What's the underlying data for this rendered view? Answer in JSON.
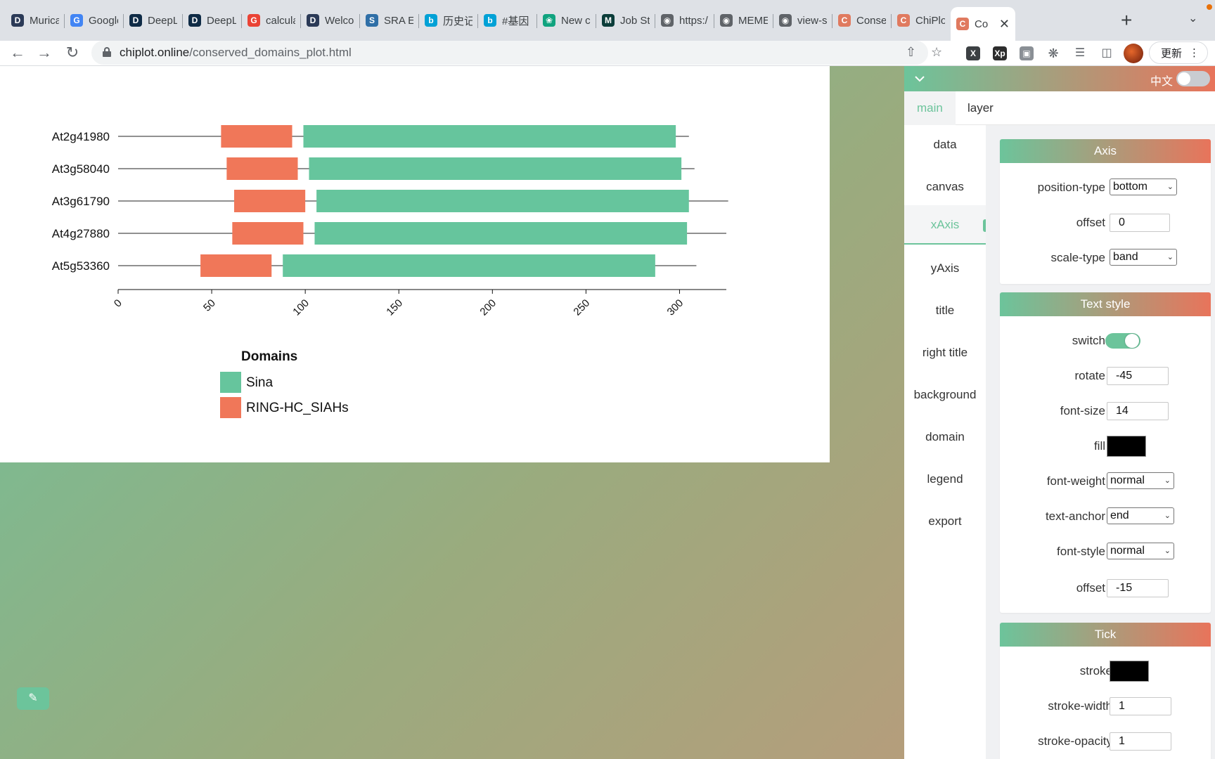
{
  "browser": {
    "tabs": [
      {
        "label": "Muricat",
        "icon": "deepl-logo-icon",
        "color": "#2b3a57"
      },
      {
        "label": "Google",
        "icon": "google-translate-icon",
        "color": "#4285f4"
      },
      {
        "label": "DeepL",
        "icon": "deepl-icon",
        "color": "#0f2b46"
      },
      {
        "label": "DeepL",
        "icon": "deepl-icon",
        "color": "#0f2b46"
      },
      {
        "label": "calcula",
        "icon": "google-icon",
        "color": "#ea4335"
      },
      {
        "label": "Welco",
        "icon": "deepl-logo-icon",
        "color": "#2b3a57"
      },
      {
        "label": "SRA E",
        "icon": "sra-icon",
        "color": "#2f6fa7"
      },
      {
        "label": "历史记",
        "icon": "bilibili-icon",
        "color": "#00a1d6"
      },
      {
        "label": "#基因",
        "icon": "bilibili-icon",
        "color": "#00a1d6"
      },
      {
        "label": "New c",
        "icon": "openai-icon",
        "color": "#10a37f"
      },
      {
        "label": "Job St",
        "icon": "m-logo-icon",
        "color": "#0b3d3a"
      },
      {
        "label": "https:/",
        "icon": "globe-icon",
        "color": "#5f6368"
      },
      {
        "label": "MEME",
        "icon": "globe-icon",
        "color": "#5f6368"
      },
      {
        "label": "view-s",
        "icon": "globe-icon",
        "color": "#5f6368"
      },
      {
        "label": "Conse",
        "icon": "chiplot-icon",
        "color": "#e07a5f"
      },
      {
        "label": "ChiPlo",
        "icon": "chiplot-icon",
        "color": "#e07a5f"
      },
      {
        "label": "Co",
        "icon": "chiplot-icon",
        "color": "#e07a5f",
        "active": true
      }
    ],
    "url_host": "chiplot.online",
    "url_path": "/conserved_domains_plot.html",
    "update_label": "更新"
  },
  "panel": {
    "lang_label": "中文",
    "top_tabs": [
      "main",
      "layer"
    ],
    "nav": [
      "data",
      "canvas",
      "xAxis",
      "yAxis",
      "title",
      "right title",
      "background",
      "domain",
      "legend",
      "export"
    ],
    "nav_active": "xAxis",
    "axis": {
      "title": "Axis",
      "position_type_label": "position-type",
      "position_type": "bottom",
      "offset_label": "offset",
      "offset": "0",
      "scale_type_label": "scale-type",
      "scale_type": "band"
    },
    "text_style": {
      "title": "Text style",
      "switch_label": "switch",
      "switch_on": true,
      "rotate_label": "rotate",
      "rotate": "-45",
      "font_size_label": "font-size",
      "font_size": "14",
      "fill_label": "fill",
      "fill": "#000000",
      "font_weight_label": "font-weight",
      "font_weight": "normal",
      "text_anchor_label": "text-anchor",
      "text_anchor": "end",
      "font_style_label": "font-style",
      "font_style": "normal",
      "offset_label": "offset",
      "offset": "-15"
    },
    "tick": {
      "title": "Tick",
      "stroke_label": "stroke",
      "stroke": "#000000",
      "stroke_width_label": "stroke-width",
      "stroke_width": "1",
      "stroke_opacity_label": "stroke-opacity",
      "stroke_opacity": "1"
    }
  },
  "chart_data": {
    "type": "bar",
    "subtype": "conserved-domains",
    "xlim": [
      0,
      325
    ],
    "x_ticks": [
      0,
      50,
      100,
      150,
      200,
      250,
      300
    ],
    "tick_rotate": -45,
    "proteins": [
      {
        "name": "At2g41980",
        "length": 305,
        "domains": [
          {
            "name": "RING-HC_SIAHs",
            "start": 55,
            "end": 93
          },
          {
            "name": "Sina",
            "start": 99,
            "end": 298
          }
        ]
      },
      {
        "name": "At3g58040",
        "length": 308,
        "domains": [
          {
            "name": "RING-HC_SIAHs",
            "start": 58,
            "end": 96
          },
          {
            "name": "Sina",
            "start": 102,
            "end": 301
          }
        ]
      },
      {
        "name": "At3g61790",
        "length": 326,
        "domains": [
          {
            "name": "RING-HC_SIAHs",
            "start": 62,
            "end": 100
          },
          {
            "name": "Sina",
            "start": 106,
            "end": 305
          }
        ]
      },
      {
        "name": "At4g27880",
        "length": 325,
        "domains": [
          {
            "name": "RING-HC_SIAHs",
            "start": 61,
            "end": 99
          },
          {
            "name": "Sina",
            "start": 105,
            "end": 304
          }
        ]
      },
      {
        "name": "At5g53360",
        "length": 309,
        "domains": [
          {
            "name": "RING-HC_SIAHs",
            "start": 44,
            "end": 82
          },
          {
            "name": "Sina",
            "start": 88,
            "end": 287
          }
        ]
      }
    ],
    "legend": {
      "title": "Domains",
      "items": [
        {
          "name": "Sina",
          "color": "#66c59d"
        },
        {
          "name": "RING-HC_SIAHs",
          "color": "#f07759"
        }
      ]
    }
  }
}
